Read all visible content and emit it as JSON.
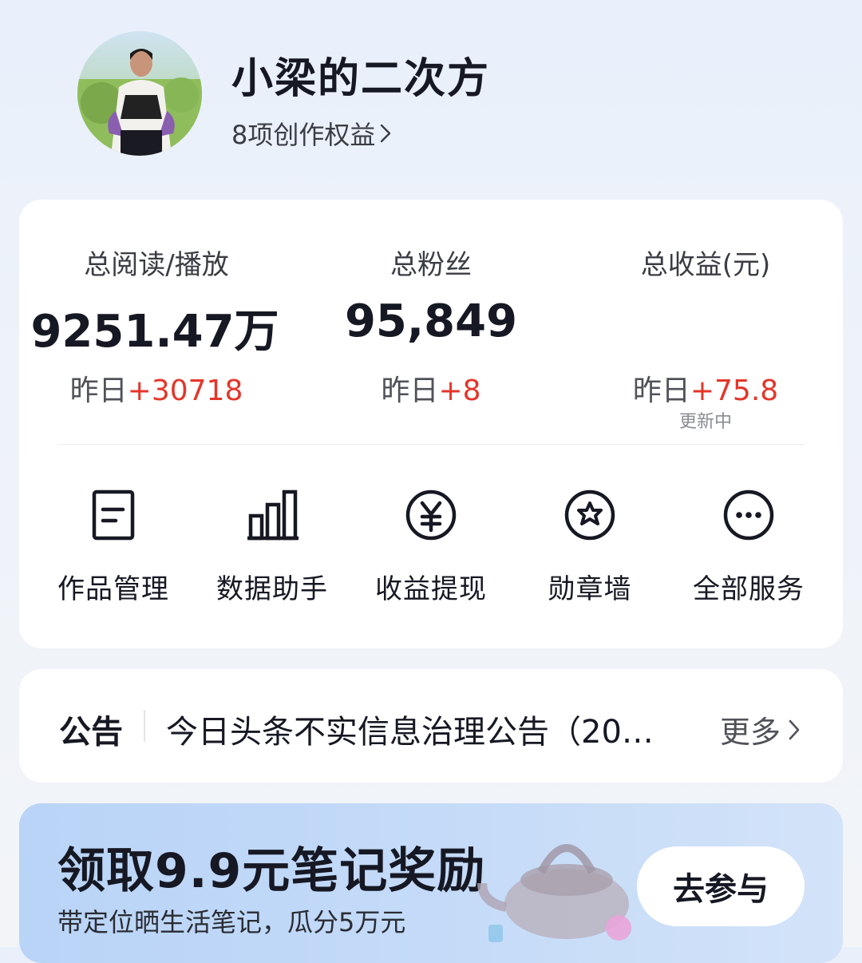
{
  "profile": {
    "username": "小梁的二次方",
    "rights_text": "8项创作权益",
    "avatar_icon": "user-avatar-photo"
  },
  "stats": [
    {
      "label": "总阅读/播放",
      "value": "9251.47万",
      "delta_prefix": "昨日",
      "delta": "+30718"
    },
    {
      "label": "总粉丝",
      "value": "95,849",
      "delta_prefix": "昨日",
      "delta": "+8"
    },
    {
      "label": "总收益(元)",
      "value": "",
      "delta_prefix": "昨日",
      "delta": "+75.8",
      "note": "更新中"
    }
  ],
  "services": [
    {
      "label": "作品管理",
      "icon": "document-icon"
    },
    {
      "label": "数据助手",
      "icon": "bar-chart-icon"
    },
    {
      "label": "收益提现",
      "icon": "yuan-coin-icon"
    },
    {
      "label": "勋章墙",
      "icon": "medal-star-icon"
    },
    {
      "label": "全部服务",
      "icon": "more-dots-icon"
    }
  ],
  "notice": {
    "tag": "公告",
    "text": "今日头条不实信息治理公告（20…",
    "more": "更多"
  },
  "promo": {
    "title": "领取9.9元笔记奖励",
    "subtitle": "带定位晒生活笔记，瓜分5万元",
    "button": "去参与"
  },
  "colors": {
    "accent_red": "#e3362a",
    "text_primary": "#161823",
    "promo_bg": "#c5dbf8"
  }
}
